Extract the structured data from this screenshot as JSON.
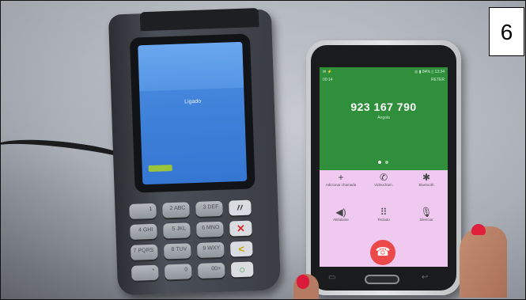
{
  "pos_terminal": {
    "screen_status": "Ligado",
    "keys": [
      {
        "label": "1"
      },
      {
        "label": "2 ABC"
      },
      {
        "label": "3 DEF"
      },
      {
        "label": "4 GHI"
      },
      {
        "label": "5 JKL"
      },
      {
        "label": "6 MNO"
      },
      {
        "label": "7 PQRS"
      },
      {
        "label": "8 TUV"
      },
      {
        "label": "9 WXY"
      },
      {
        "label": "*"
      },
      {
        "label": "0"
      },
      {
        "label": "00+"
      }
    ],
    "function_keys": {
      "clear": "〃",
      "cancel": "✕",
      "back": "<",
      "enter": "○"
    }
  },
  "phone": {
    "status_left": "✉ ⚡",
    "status_right": "◎ ▮ 84% ▯ 13:34",
    "call_time": "00:14",
    "call_reject_label": "RETER",
    "phone_number": "923 167 790",
    "call_country": "Angola",
    "controls": [
      {
        "icon": "+",
        "label": "Adicionar chamada"
      },
      {
        "icon": "✆",
        "label": "Videocham."
      },
      {
        "icon": "✱",
        "label": "Bluetooth"
      },
      {
        "icon": "◀)",
        "label": "Altifalante"
      },
      {
        "icon": "⠿",
        "label": "Teclado"
      },
      {
        "icon": "🎙",
        "label": "Silenciar"
      }
    ],
    "end_call_icon": "☎"
  },
  "badge_number": "6"
}
